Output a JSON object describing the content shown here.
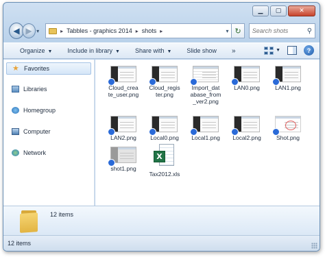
{
  "address": {
    "crumbs": [
      "Tabbles - graphics 2014",
      "shots"
    ]
  },
  "search": {
    "placeholder": "Search shots"
  },
  "toolbar": {
    "organize": "Organize",
    "include_in_library": "Include in library",
    "share_with": "Share with",
    "slide_show": "Slide show",
    "more": "»"
  },
  "navpane": {
    "favorites": "Favorites",
    "libraries": "Libraries",
    "homegroup": "Homegroup",
    "computer": "Computer",
    "network": "Network"
  },
  "files": [
    {
      "name": "Cloud_create_user.png",
      "label": "Cloud_crea\nte_user.png",
      "thumb": "dark",
      "icon": "image-thumbnail-icon"
    },
    {
      "name": "Cloud_register.png",
      "label": "Cloud_regis\nter.png",
      "thumb": "dark",
      "icon": "image-thumbnail-icon"
    },
    {
      "name": "Import_database_from_ver2.png",
      "label": "Import_dat\nabase_from\n_ver2.png",
      "thumb": "doc",
      "icon": "image-thumbnail-icon"
    },
    {
      "name": "LAN0.png",
      "label": "LAN0.png",
      "thumb": "dark",
      "icon": "image-thumbnail-icon"
    },
    {
      "name": "LAN1.png",
      "label": "LAN1.png",
      "thumb": "dark",
      "icon": "image-thumbnail-icon"
    },
    {
      "name": "LAN2.png",
      "label": "LAN2.png",
      "thumb": "dark",
      "icon": "image-thumbnail-icon"
    },
    {
      "name": "Local0.png",
      "label": "Local0.png",
      "thumb": "dark",
      "icon": "image-thumbnail-icon"
    },
    {
      "name": "Local1.png",
      "label": "Local1.png",
      "thumb": "dark",
      "icon": "image-thumbnail-icon"
    },
    {
      "name": "Local2.png",
      "label": "Local2.png",
      "thumb": "dark",
      "icon": "image-thumbnail-icon"
    },
    {
      "name": "Shot.png",
      "label": "Shot.png",
      "thumb": "shot",
      "icon": "image-thumbnail-icon"
    },
    {
      "name": "shot1.png",
      "label": "shot1.png",
      "thumb": "gray",
      "icon": "image-thumbnail-icon"
    },
    {
      "name": "Tax2012.xls",
      "label": "Tax2012.xls",
      "thumb": "xls",
      "icon": "excel-file-icon"
    }
  ],
  "details": {
    "item_count": "12 items"
  },
  "status": {
    "item_count": "12 items"
  },
  "colors": {
    "accent": "#2a6ad8",
    "chrome": "#b9d1ea",
    "folder": "#e2b443"
  }
}
